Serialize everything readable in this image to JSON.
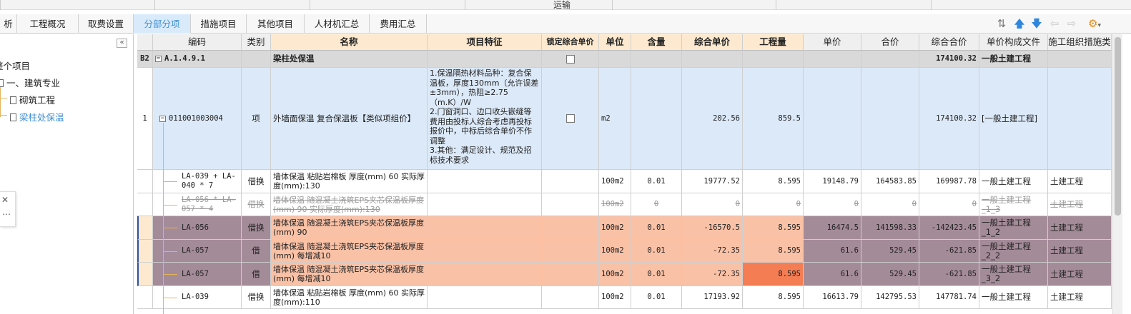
{
  "window": {
    "title": "运输"
  },
  "tabs": [
    {
      "label": "析"
    },
    {
      "label": "工程概况"
    },
    {
      "label": "取费设置"
    },
    {
      "label": "分部分项",
      "active": true
    },
    {
      "label": "措施项目"
    },
    {
      "label": "其他项目"
    },
    {
      "label": "人材机汇总"
    },
    {
      "label": "费用汇总"
    }
  ],
  "toolbar_icons": [
    "sort-icon",
    "move-up-icon",
    "move-down-icon",
    "back-arrow-icon",
    "forward-arrow-icon",
    "settings-dropdown-icon"
  ],
  "tree": {
    "root": "整个项目",
    "level1": "一、建筑专业",
    "items": [
      {
        "label": "砌筑工程"
      },
      {
        "label": "梁柱处保温",
        "selected": true
      }
    ]
  },
  "table": {
    "headers": [
      "编码",
      "类别",
      "名称",
      "项目特征",
      "锁定综合单价",
      "单位",
      "含量",
      "综合单价",
      "工程量",
      "单价",
      "合价",
      "综合合价",
      "单价构成文件",
      "施工组织措施类"
    ],
    "section": {
      "no": "B2",
      "code": "A.1.4.9.1",
      "name": "梁柱处保温",
      "total": "174100.32",
      "file": "一般土建工程"
    },
    "item": {
      "no": "1",
      "code": "011001003004",
      "type": "项",
      "name": "外墙面保温 复合保温板【类似项组价】",
      "feature": "1.保温隔热材料品种：复合保温板，厚度130mm（允许误差±3mm），热阻≥2.75（m.K）/W\n2.门窗洞口、边口收头嵌缝等费用由投标人综合考虑再投标报价中，中标后综合单价不作调整\n3.其他：满足设计、规范及招标技术要求",
      "unit": "m2",
      "unit_price": "202.56",
      "quantity": "859.5",
      "total": "174100.32",
      "file": "[一般土建工程]"
    },
    "rows": [
      {
        "code": "LA-039 + LA-040 * 7",
        "type": "借换",
        "name": "墙体保温 粘贴岩棉板 厚度(mm) 60 实际厚度(mm):130",
        "unit": "100m2",
        "content": "0.01",
        "unit_price": "19777.52",
        "quantity": "8.595",
        "price": "19148.79",
        "amount": "164583.85",
        "total": "169987.78",
        "file": "一般土建工程",
        "org": "土建工程",
        "style": "normal"
      },
      {
        "code": "LA-056 * LA-057 * 4",
        "type": "借换",
        "name": "墙体保温 随混凝土浇筑EPS夹芯保温板厚度(mm) 90 实际厚度(mm):130",
        "unit": "100m2",
        "content": "0",
        "unit_price": "0",
        "quantity": "0",
        "price": "0",
        "amount": "0",
        "total": "0",
        "file": "一般土建工程_1_3",
        "org": "土建工程",
        "style": "strike"
      },
      {
        "code": "LA-056",
        "type": "借换",
        "name": "墙体保温 随混凝土浇筑EPS夹芯保温板厚度(mm) 90",
        "unit": "100m2",
        "content": "0.01",
        "unit_price": "-16570.5",
        "quantity": "8.595",
        "price": "16474.5",
        "amount": "141598.33",
        "total": "-142423.45",
        "file": "一般土建工程_1_2",
        "org": "土建工程",
        "style": "hl"
      },
      {
        "code": "LA-057",
        "type": "借",
        "name": "墙体保温 随混凝土浇筑EPS夹芯保温板厚度(mm) 每增减10",
        "unit": "100m2",
        "content": "0.01",
        "unit_price": "-72.35",
        "quantity": "8.595",
        "price": "61.6",
        "amount": "529.45",
        "total": "-621.85",
        "file": "一般土建工程_2_2",
        "org": "土建工程",
        "style": "hl"
      },
      {
        "code": "LA-057",
        "type": "借",
        "name": "墙体保温 随混凝土浇筑EPS夹芯保温板厚度(mm) 每增减10",
        "unit": "100m2",
        "content": "0.01",
        "unit_price": "-72.35",
        "quantity": "8.595",
        "price": "61.6",
        "amount": "529.45",
        "total": "-621.85",
        "file": "一般土建工程_3_2",
        "org": "土建工程",
        "style": "hl-active"
      },
      {
        "code": "LA-039",
        "type": "借换",
        "name": "墙体保温 粘贴岩棉板 厚度(mm) 60 实际厚度(mm):110",
        "unit": "100m2",
        "content": "0.01",
        "unit_price": "17193.92",
        "quantity": "8.595",
        "price": "16613.79",
        "amount": "142795.53",
        "total": "147781.74",
        "file": "一般土建工程",
        "org": "土建工程",
        "style": "normal"
      }
    ]
  },
  "colors": {
    "accent": "#3d8fd6",
    "header_orange": "#fde9cf",
    "row_blue": "#dce9f8",
    "row_mauve": "#a48b98",
    "cell_salmon": "#f9c1a6",
    "cell_active": "#f47d54"
  }
}
